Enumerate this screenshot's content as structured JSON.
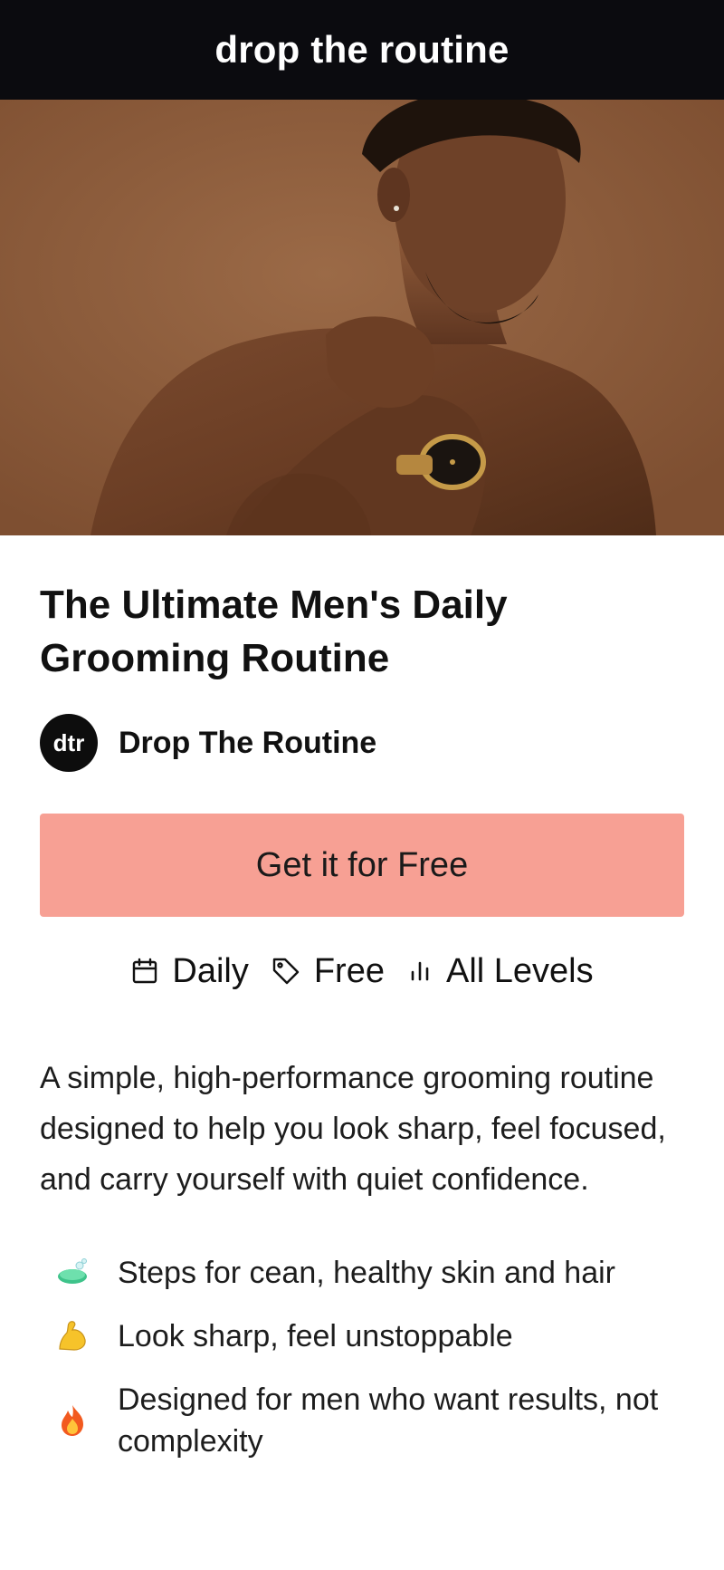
{
  "header": {
    "brand": "drop the routine"
  },
  "hero": {
    "image": "man-portrait-photo"
  },
  "product": {
    "title": "The Ultimate Men's Daily Grooming Routine",
    "author": {
      "avatar_text": "dtr",
      "name": "Drop The Routine"
    },
    "cta_label": "Get it for Free",
    "meta": [
      {
        "icon": "calendar-icon",
        "label": "Daily"
      },
      {
        "icon": "tag-icon",
        "label": "Free"
      },
      {
        "icon": "levels-bars-icon",
        "label": "All Levels"
      }
    ],
    "description": "A simple, high-performance grooming routine designed to help you look sharp, feel focused, and carry yourself with quiet confidence.",
    "benefits": [
      {
        "icon": "soap-icon",
        "text": "Steps for cean, healthy skin and hair"
      },
      {
        "icon": "flexed-biceps-icon",
        "text": "Look sharp, feel unstoppable"
      },
      {
        "icon": "fire-icon",
        "text": "Designed for men who want results, not complexity"
      }
    ]
  },
  "colors": {
    "topbar_bg": "#0b0b0f",
    "cta_bg": "#f7a094",
    "hero_bg": "#8f5e3e"
  }
}
